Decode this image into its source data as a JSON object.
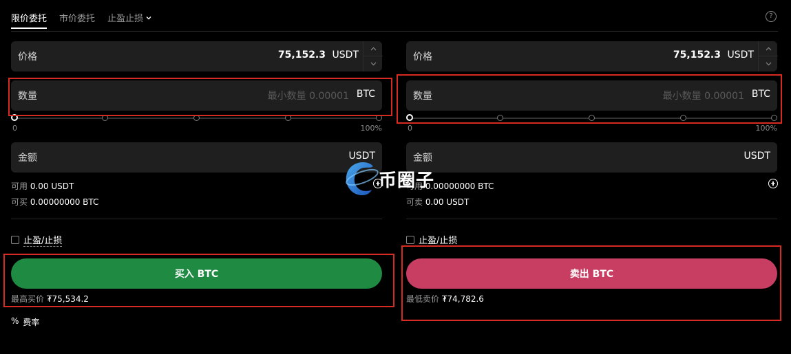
{
  "tabs": [
    {
      "label": "限价委托",
      "active": true
    },
    {
      "label": "市价委托",
      "active": false
    },
    {
      "label": "止盈止损",
      "active": false,
      "dropdown": true
    }
  ],
  "help_icon": "question-circle-icon",
  "buy": {
    "price": {
      "label": "价格",
      "value": "75,152.3",
      "unit": "USDT"
    },
    "quantity": {
      "label": "数量",
      "placeholder": "最小数量 0.00001",
      "unit": "BTC"
    },
    "slider": {
      "min_label": "0",
      "max_label": "100%",
      "level": 0
    },
    "amount": {
      "label": "金额",
      "unit": "USDT"
    },
    "available_label": "可用",
    "available_value": "0.00 USDT",
    "can_label": "可买",
    "can_value": "0.00000000 BTC",
    "tpsl_label": "止盈/止损",
    "button_label": "买入 BTC",
    "best_label": "最高买价",
    "best_value": "₮75,534.2",
    "fee_icon": "%",
    "fee_label": "费率"
  },
  "sell": {
    "price": {
      "label": "价格",
      "value": "75,152.3",
      "unit": "USDT"
    },
    "quantity": {
      "label": "数量",
      "placeholder": "最小数量 0.00001",
      "unit": "BTC"
    },
    "slider": {
      "min_label": "0",
      "max_label": "100%",
      "level": 0
    },
    "amount": {
      "label": "金额",
      "unit": "USDT"
    },
    "available_label": "可用",
    "available_value": "0.00000000 BTC",
    "can_label": "可卖",
    "can_value": "0.00 USDT",
    "tpsl_label": "止盈/止损",
    "button_label": "卖出 BTC",
    "best_label": "最低卖价",
    "best_value": "₮74,782.6"
  },
  "watermark": {
    "text": "币圈子"
  },
  "colors": {
    "buy": "#1e8a42",
    "sell": "#c73e62",
    "highlight": "#d72a21",
    "field_bg": "#1f1f1f"
  }
}
